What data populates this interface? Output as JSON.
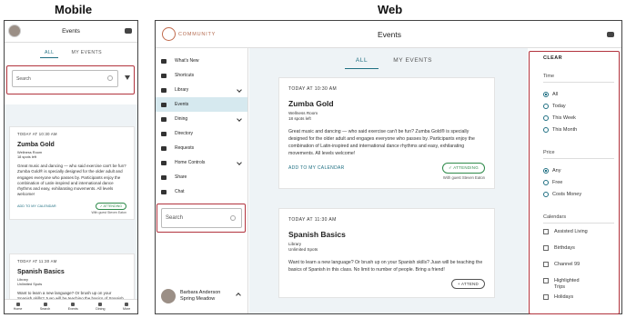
{
  "labels": {
    "mobile": "Mobile",
    "web": "Web"
  },
  "header": {
    "title": "Events"
  },
  "tabs": [
    "ALL",
    "MY EVENTS"
  ],
  "search": {
    "placeholder": "Search"
  },
  "events": [
    {
      "when": "TODAY AT 10:30 AM",
      "title": "Zumba Gold",
      "room": "Wellness Room",
      "spots": "18 spots left",
      "desc": "Great music and dancing — who said exercise can't be fun? Zumba Gold® is specially designed for the older adult and engages everyone who passes by. Participants enjoy the combination of Latin-inspired and international dance rhythms and easy, exhilarating movements. All levels welcome!",
      "add": "ADD TO MY CALENDAR",
      "status": "✓ ATTENDING",
      "guest": "With guest Steven Eaton"
    },
    {
      "when": "TODAY AT 11:30 AM",
      "title": "Spanish Basics",
      "room": "Library",
      "spots": "Unlimited Spots",
      "desc": "Want to learn a new language? Or brush up on your Spanish skills? Juan will be teaching the basics of Spanish in this class. No limit to number of people. Bring a friend!",
      "attend": "+ ATTEND"
    }
  ],
  "mobile_nav": [
    "Home",
    "Search",
    "Events",
    "Dining",
    "More"
  ],
  "sidebar": {
    "items": [
      {
        "label": "What's New",
        "chev": false
      },
      {
        "label": "Shortcuts",
        "chev": false
      },
      {
        "label": "Library",
        "chev": true
      },
      {
        "label": "Events",
        "chev": false
      },
      {
        "label": "Dining",
        "chev": true
      },
      {
        "label": "Directory",
        "chev": false
      },
      {
        "label": "Requests",
        "chev": false
      },
      {
        "label": "Home Controls",
        "chev": true
      },
      {
        "label": "Share",
        "chev": false
      },
      {
        "label": "Chat",
        "chev": false
      }
    ]
  },
  "logo_text": "COMMUNITY",
  "user": {
    "name": "Barbara Anderson",
    "place": "Spring Meadow"
  },
  "filters": {
    "clear": "CLEAR",
    "time": {
      "heading": "Time",
      "options": [
        "All",
        "Today",
        "This Week",
        "This Month"
      ]
    },
    "price": {
      "heading": "Price",
      "options": [
        "Any",
        "Free",
        "Costs Money"
      ]
    },
    "calendars": {
      "heading": "Calendars",
      "options": [
        "Assisted Living",
        "Birthdays",
        "Channel 99",
        "Highlighted Trips",
        "Holidays"
      ]
    }
  }
}
